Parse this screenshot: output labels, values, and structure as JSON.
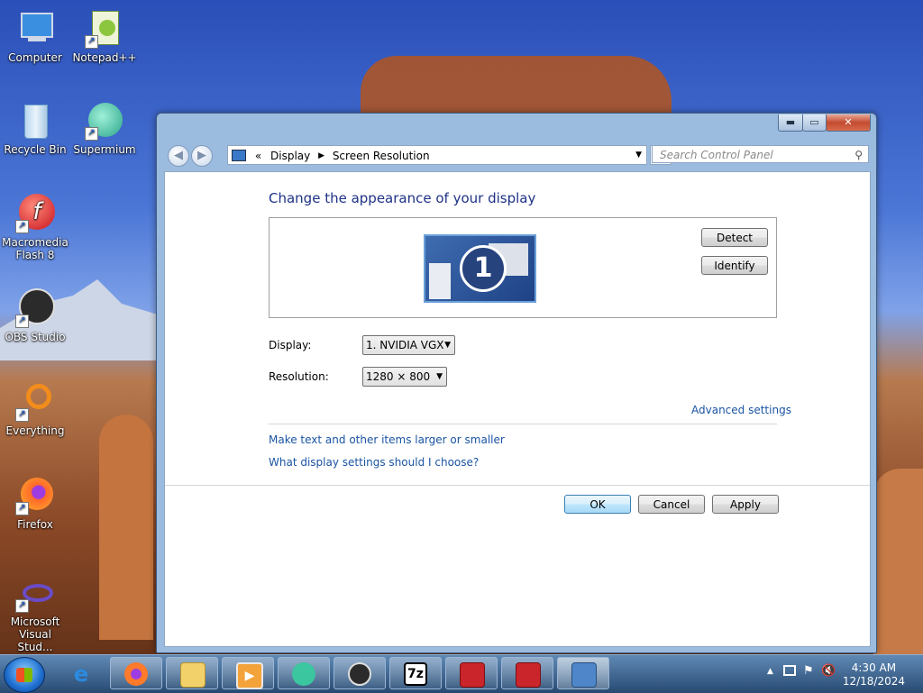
{
  "desktop": {
    "icons": [
      {
        "label": "Computer"
      },
      {
        "label": "Notepad++"
      },
      {
        "label": "Recycle Bin"
      },
      {
        "label": "Supermium"
      },
      {
        "label": "Macromedia Flash 8"
      },
      {
        "label": "OBS Studio"
      },
      {
        "label": "Everything"
      },
      {
        "label": "Firefox"
      },
      {
        "label": "Microsoft Visual Stud..."
      }
    ]
  },
  "window": {
    "controls": {
      "minimize": "▬",
      "maximize": "▭",
      "close": "✕"
    },
    "address": {
      "prefix": "«",
      "crumbs": [
        "Display",
        "Screen Resolution"
      ]
    },
    "search": {
      "placeholder": "Search Control Panel"
    },
    "title": "Change the appearance of your display",
    "monitor_number": "1",
    "buttons": {
      "detect": "Detect",
      "identify": "Identify",
      "ok": "OK",
      "cancel": "Cancel",
      "apply": "Apply"
    },
    "display_label": "Display:",
    "display_value": "1. NVIDIA VGX",
    "resolution_label": "Resolution:",
    "resolution_value": "1280 × 800",
    "links": {
      "advanced": "Advanced settings",
      "text_size": "Make text and other items larger or smaller",
      "which_settings": "What display settings should I choose?"
    }
  },
  "taskbar": {
    "apps": [
      {
        "icon": "ie-icon"
      },
      {
        "icon": "firefox-icon"
      },
      {
        "icon": "explorer-icon"
      },
      {
        "icon": "media-player-icon"
      },
      {
        "icon": "supermium-icon"
      },
      {
        "icon": "obs-icon"
      },
      {
        "icon": "7zip-icon",
        "glyph": "7z"
      },
      {
        "icon": "toolbox-icon"
      },
      {
        "icon": "toolbox-icon"
      },
      {
        "icon": "control-panel-icon"
      }
    ],
    "clock": {
      "time": "4:30 AM",
      "date": "12/18/2024"
    }
  },
  "colors": {
    "accent": "#1a54a3",
    "title": "#1e3287"
  }
}
